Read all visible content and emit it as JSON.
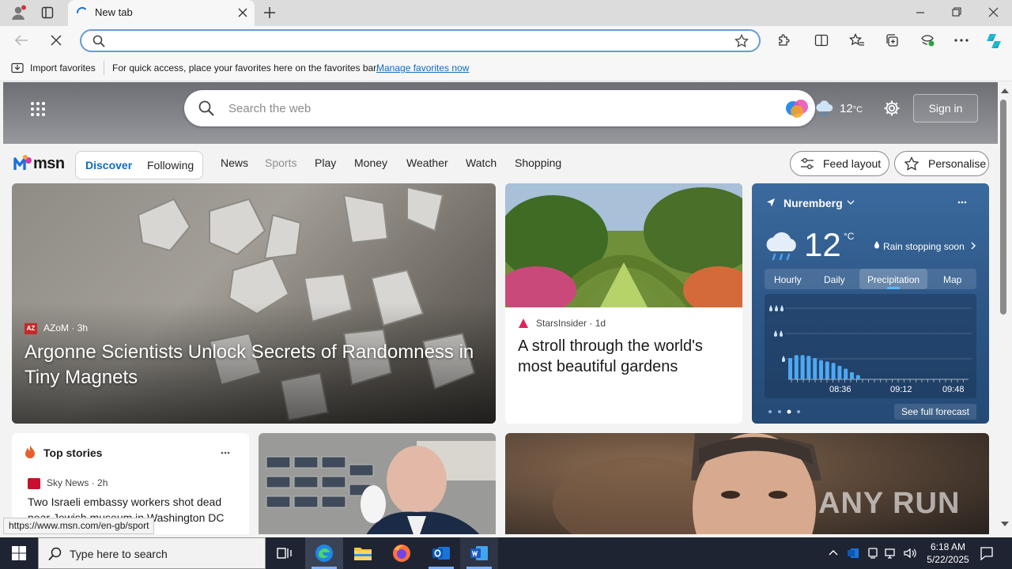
{
  "browser": {
    "tab_title": "New tab",
    "favorites_bar": {
      "import_label": "Import favorites",
      "hint": "For quick access, place your favorites here on the favorites bar.",
      "manage_link": "Manage favorites now"
    },
    "status_url": "https://www.msn.com/en-gb/sport"
  },
  "msn": {
    "search_placeholder": "Search the web",
    "header_temp": "12",
    "header_temp_unit": "°C",
    "sign_in": "Sign in",
    "logo_text": "msn",
    "feed_tabs": [
      "Discover",
      "Following"
    ],
    "nav": [
      "News",
      "Sports",
      "Play",
      "Money",
      "Weather",
      "Watch",
      "Shopping"
    ],
    "feed_layout": "Feed layout",
    "personalise": "Personalise",
    "hero": {
      "source": "AZoM",
      "age": "3h",
      "headline": "Argonne Scientists Unlock Secrets of Randomness in Tiny Magnets"
    },
    "garden": {
      "source": "StarsInsider",
      "age": "1d",
      "headline": "A stroll through the world's most beautiful gardens"
    },
    "weather": {
      "city": "Nuremberg",
      "temp": "12",
      "unit": "°C",
      "condition": "Rain stopping soon",
      "tabs": [
        "Hourly",
        "Daily",
        "Precipitation",
        "Map"
      ],
      "active_tab": "Precipitation",
      "times": [
        "08:36",
        "09:12",
        "09:48"
      ],
      "see_forecast": "See full forecast",
      "precip_levels": [
        0.6,
        0.68,
        0.68,
        0.66,
        0.6,
        0.54,
        0.5,
        0.46,
        0.38,
        0.3,
        0.2,
        0.12
      ]
    },
    "top_stories": {
      "title": "Top stories",
      "source": "Sky News",
      "age": "2h",
      "headline": "Two Israeli embassy workers shot dead near Jewish museum in Washington DC"
    },
    "watermark": "ANY RUN"
  },
  "taskbar": {
    "search_placeholder": "Type here to search",
    "time": "6:18 AM",
    "date": "5/22/2025"
  },
  "colors": {
    "accent": "#0f6cbd",
    "address_border": "#6a9ad8",
    "taskbar": "#1f2433",
    "weather_card": "#2e5a8c"
  }
}
